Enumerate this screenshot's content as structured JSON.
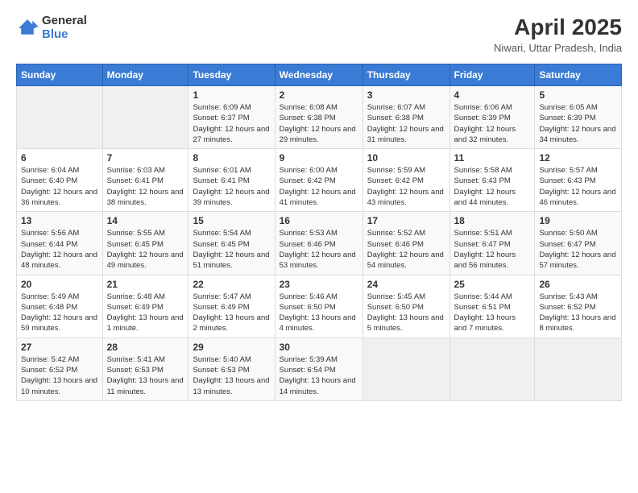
{
  "header": {
    "logo_general": "General",
    "logo_blue": "Blue",
    "month_title": "April 2025",
    "location": "Niwari, Uttar Pradesh, India"
  },
  "weekdays": [
    "Sunday",
    "Monday",
    "Tuesday",
    "Wednesday",
    "Thursday",
    "Friday",
    "Saturday"
  ],
  "weeks": [
    [
      null,
      null,
      {
        "day": "1",
        "sunrise": "6:09 AM",
        "sunset": "6:37 PM",
        "daylight": "12 hours and 27 minutes."
      },
      {
        "day": "2",
        "sunrise": "6:08 AM",
        "sunset": "6:38 PM",
        "daylight": "12 hours and 29 minutes."
      },
      {
        "day": "3",
        "sunrise": "6:07 AM",
        "sunset": "6:38 PM",
        "daylight": "12 hours and 31 minutes."
      },
      {
        "day": "4",
        "sunrise": "6:06 AM",
        "sunset": "6:39 PM",
        "daylight": "12 hours and 32 minutes."
      },
      {
        "day": "5",
        "sunrise": "6:05 AM",
        "sunset": "6:39 PM",
        "daylight": "12 hours and 34 minutes."
      }
    ],
    [
      {
        "day": "6",
        "sunrise": "6:04 AM",
        "sunset": "6:40 PM",
        "daylight": "12 hours and 36 minutes."
      },
      {
        "day": "7",
        "sunrise": "6:03 AM",
        "sunset": "6:41 PM",
        "daylight": "12 hours and 38 minutes."
      },
      {
        "day": "8",
        "sunrise": "6:01 AM",
        "sunset": "6:41 PM",
        "daylight": "12 hours and 39 minutes."
      },
      {
        "day": "9",
        "sunrise": "6:00 AM",
        "sunset": "6:42 PM",
        "daylight": "12 hours and 41 minutes."
      },
      {
        "day": "10",
        "sunrise": "5:59 AM",
        "sunset": "6:42 PM",
        "daylight": "12 hours and 43 minutes."
      },
      {
        "day": "11",
        "sunrise": "5:58 AM",
        "sunset": "6:43 PM",
        "daylight": "12 hours and 44 minutes."
      },
      {
        "day": "12",
        "sunrise": "5:57 AM",
        "sunset": "6:43 PM",
        "daylight": "12 hours and 46 minutes."
      }
    ],
    [
      {
        "day": "13",
        "sunrise": "5:56 AM",
        "sunset": "6:44 PM",
        "daylight": "12 hours and 48 minutes."
      },
      {
        "day": "14",
        "sunrise": "5:55 AM",
        "sunset": "6:45 PM",
        "daylight": "12 hours and 49 minutes."
      },
      {
        "day": "15",
        "sunrise": "5:54 AM",
        "sunset": "6:45 PM",
        "daylight": "12 hours and 51 minutes."
      },
      {
        "day": "16",
        "sunrise": "5:53 AM",
        "sunset": "6:46 PM",
        "daylight": "12 hours and 53 minutes."
      },
      {
        "day": "17",
        "sunrise": "5:52 AM",
        "sunset": "6:46 PM",
        "daylight": "12 hours and 54 minutes."
      },
      {
        "day": "18",
        "sunrise": "5:51 AM",
        "sunset": "6:47 PM",
        "daylight": "12 hours and 56 minutes."
      },
      {
        "day": "19",
        "sunrise": "5:50 AM",
        "sunset": "6:47 PM",
        "daylight": "12 hours and 57 minutes."
      }
    ],
    [
      {
        "day": "20",
        "sunrise": "5:49 AM",
        "sunset": "6:48 PM",
        "daylight": "12 hours and 59 minutes."
      },
      {
        "day": "21",
        "sunrise": "5:48 AM",
        "sunset": "6:49 PM",
        "daylight": "13 hours and 1 minute."
      },
      {
        "day": "22",
        "sunrise": "5:47 AM",
        "sunset": "6:49 PM",
        "daylight": "13 hours and 2 minutes."
      },
      {
        "day": "23",
        "sunrise": "5:46 AM",
        "sunset": "6:50 PM",
        "daylight": "13 hours and 4 minutes."
      },
      {
        "day": "24",
        "sunrise": "5:45 AM",
        "sunset": "6:50 PM",
        "daylight": "13 hours and 5 minutes."
      },
      {
        "day": "25",
        "sunrise": "5:44 AM",
        "sunset": "6:51 PM",
        "daylight": "13 hours and 7 minutes."
      },
      {
        "day": "26",
        "sunrise": "5:43 AM",
        "sunset": "6:52 PM",
        "daylight": "13 hours and 8 minutes."
      }
    ],
    [
      {
        "day": "27",
        "sunrise": "5:42 AM",
        "sunset": "6:52 PM",
        "daylight": "13 hours and 10 minutes."
      },
      {
        "day": "28",
        "sunrise": "5:41 AM",
        "sunset": "6:53 PM",
        "daylight": "13 hours and 11 minutes."
      },
      {
        "day": "29",
        "sunrise": "5:40 AM",
        "sunset": "6:53 PM",
        "daylight": "13 hours and 13 minutes."
      },
      {
        "day": "30",
        "sunrise": "5:39 AM",
        "sunset": "6:54 PM",
        "daylight": "13 hours and 14 minutes."
      },
      null,
      null,
      null
    ]
  ],
  "labels": {
    "sunrise_prefix": "Sunrise: ",
    "sunset_prefix": "Sunset: ",
    "daylight_prefix": "Daylight: "
  }
}
